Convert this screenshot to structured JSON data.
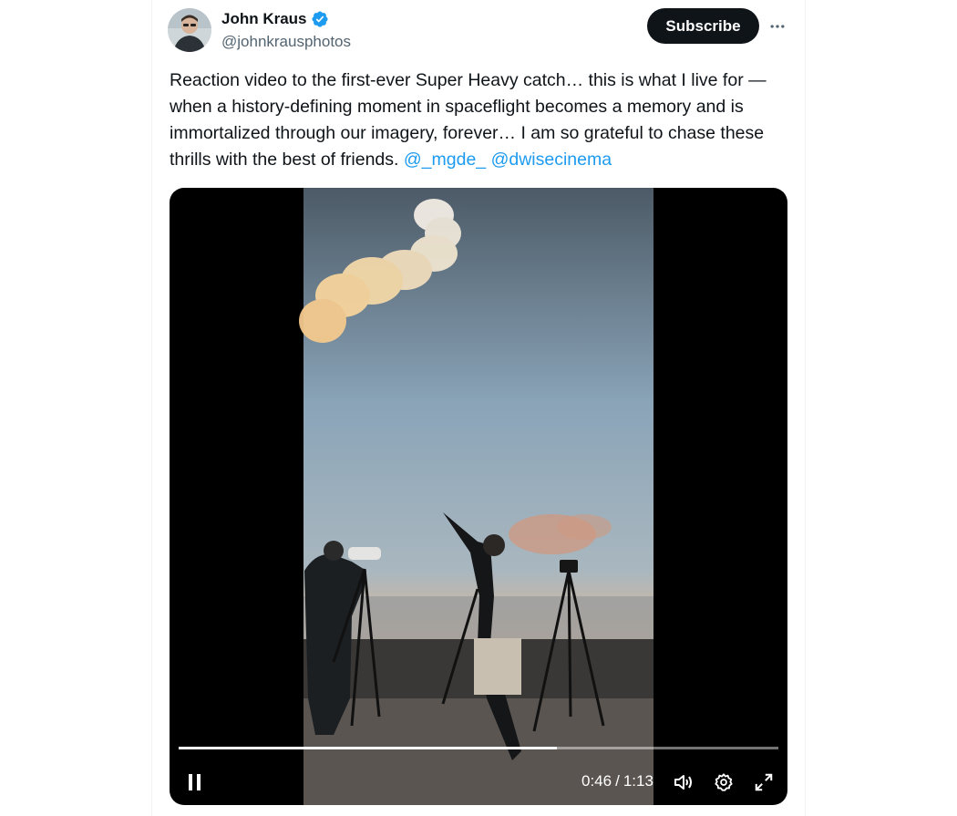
{
  "author": {
    "display_name": "John Kraus",
    "handle": "@johnkrausphotos",
    "verified": true
  },
  "actions": {
    "subscribe_label": "Subscribe",
    "more_icon": "more-horizontal-icon"
  },
  "tweet": {
    "text": "Reaction video to the first-ever Super Heavy catch… this is what I live for — when a history-defining moment in spaceflight becomes a memory and is immortalized through our imagery, forever… I am so grateful to chase these thrills with the best of friends.",
    "mentions": [
      "@_mgde_",
      "@dwisecinema"
    ]
  },
  "video": {
    "current_time": "0:46",
    "separator": "/",
    "duration": "1:13",
    "progress": 0.63,
    "state": "playing",
    "controls": [
      "pause-icon",
      "volume-icon",
      "settings-icon",
      "fullscreen-icon"
    ]
  },
  "colors": {
    "accent": "#1d9bf0",
    "text": "#0f1419",
    "secondary_text": "#536471",
    "button_bg": "#0f1419"
  }
}
